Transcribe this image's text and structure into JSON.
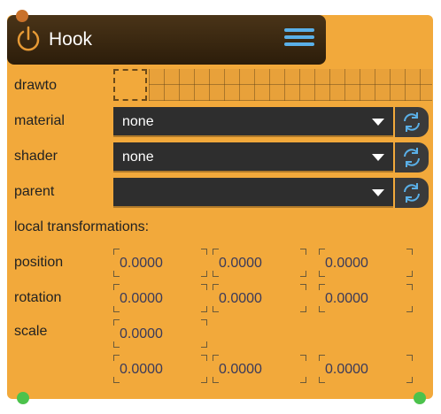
{
  "node": {
    "title": "Hook",
    "icons": {
      "power": "power-icon",
      "menu": "hamburger-menu-icon",
      "reload": "refresh-icon"
    }
  },
  "labels": {
    "drawto": "drawto",
    "material": "material",
    "shader": "shader",
    "parent": "parent",
    "local_transformations": "local transformations:",
    "position": "position",
    "rotation": "rotation",
    "scale": "scale"
  },
  "fields": {
    "material": "none",
    "shader": "none",
    "parent": ""
  },
  "transform": {
    "position": [
      "0.0000",
      "0.0000",
      "0.0000"
    ],
    "rotation": [
      "0.0000",
      "0.0000",
      "0.0000"
    ],
    "scale_single": "0.0000",
    "scale": [
      "0.0000",
      "0.0000",
      "0.0000"
    ]
  },
  "colors": {
    "panel": "#f2a93b",
    "header": "#2c1d0a",
    "accent": "#5ab0e8",
    "port": "#4cc24c"
  }
}
